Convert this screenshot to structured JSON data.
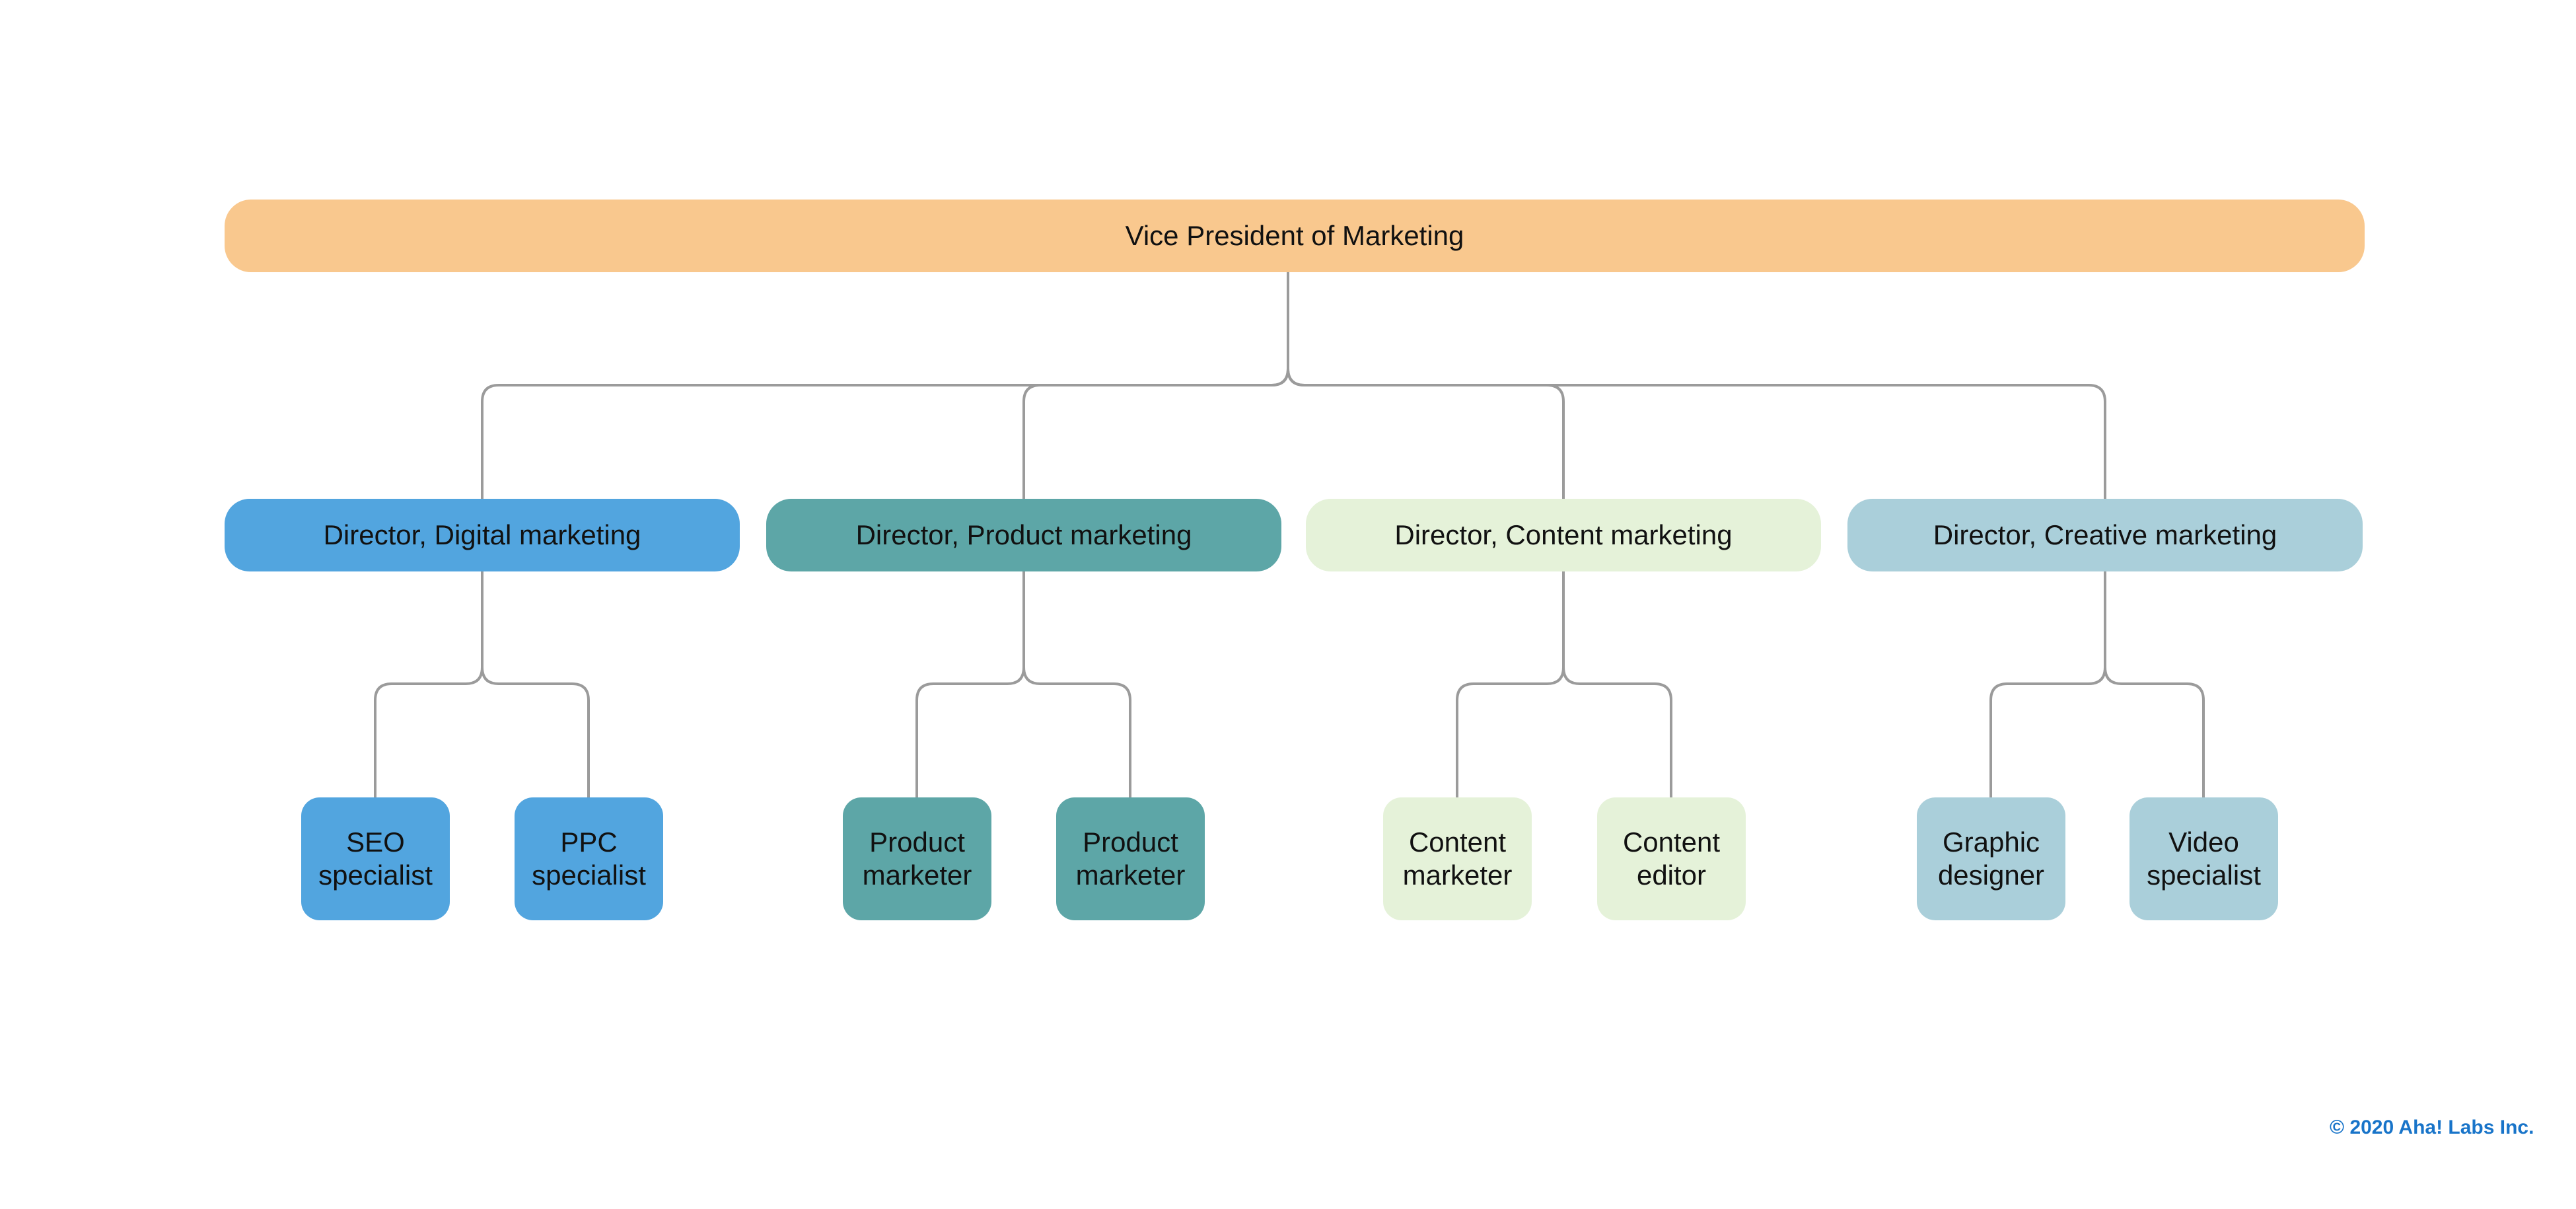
{
  "title": "Vice President of Marketing",
  "colors": {
    "vp": "#F9C88E",
    "digital": "#52A5DF",
    "product": "#5DA6A7",
    "content": "#E5F2D9",
    "creative": "#AACFDA",
    "connector": "#9B9B9B",
    "copyright": "#1874C9"
  },
  "vp": {
    "label": "Vice President of Marketing"
  },
  "directors": [
    {
      "label": "Director, Digital marketing",
      "color_key": "digital",
      "reports": [
        {
          "label": "SEO specialist"
        },
        {
          "label": "PPC specialist"
        }
      ]
    },
    {
      "label": "Director, Product marketing",
      "color_key": "product",
      "reports": [
        {
          "label": "Product marketer"
        },
        {
          "label": "Product marketer"
        }
      ]
    },
    {
      "label": "Director, Content marketing",
      "color_key": "content",
      "reports": [
        {
          "label": "Content marketer"
        },
        {
          "label": "Content editor"
        }
      ]
    },
    {
      "label": "Director, Creative marketing",
      "color_key": "creative",
      "reports": [
        {
          "label": "Graphic designer"
        },
        {
          "label": "Video specialist"
        }
      ]
    }
  ],
  "footer": {
    "copyright": "© 2020 Aha! Labs Inc."
  }
}
